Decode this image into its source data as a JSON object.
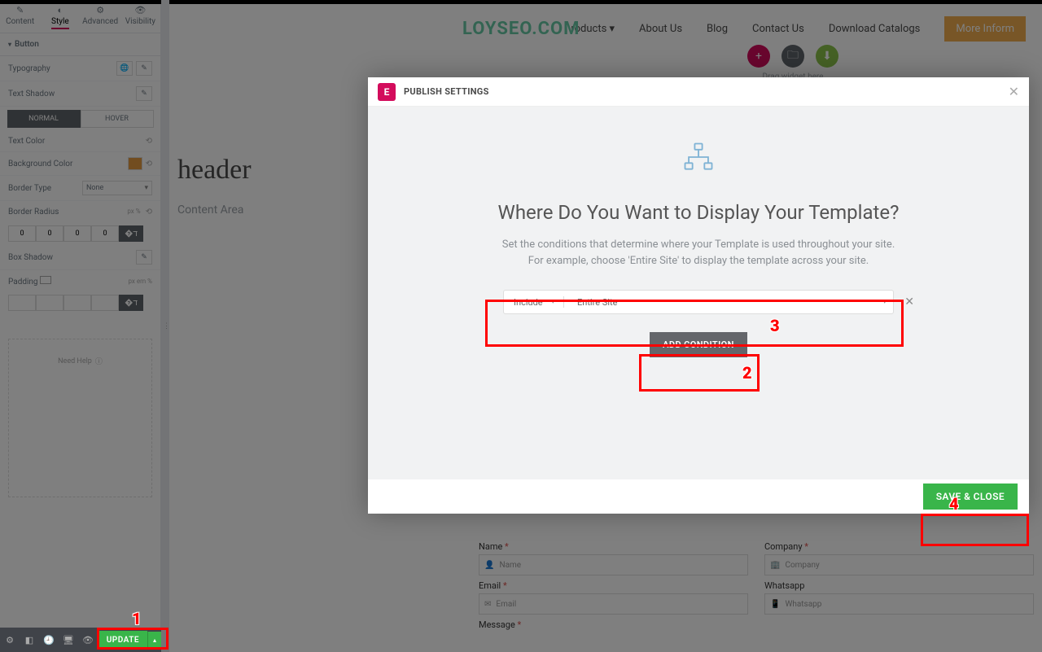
{
  "watermark": "LOYSEO.COM",
  "sidebar": {
    "tabs": [
      "Content",
      "Style",
      "Advanced",
      "Visibility"
    ],
    "active_tab_index": 1,
    "section": "Button",
    "rows": {
      "typography": "Typography",
      "text_shadow": "Text Shadow",
      "normal": "NORMAL",
      "hover": "HOVER",
      "text_color": "Text Color",
      "bg_color": "Background Color",
      "border_type": "Border Type",
      "border_type_value": "None",
      "border_radius": "Border Radius",
      "radius_values": [
        "0",
        "0",
        "0",
        "0"
      ],
      "box_shadow": "Box Shadow",
      "padding": "Padding",
      "help": "Need Help"
    },
    "bottom": {
      "update": "UPDATE"
    }
  },
  "canvas": {
    "logo": "LOYSEO.COM",
    "menu": {
      "products": "roducts",
      "about": "About Us",
      "blog": "Blog",
      "contact": "Contact Us",
      "download": "Download Catalogs",
      "cta": "More Inform"
    },
    "header_text": "header",
    "content_area": "Content Area",
    "drag_hint": "Drag widget here",
    "form": {
      "name_label": "Name",
      "name_ph": "Name",
      "company_label": "Company",
      "company_ph": "Company",
      "email_label": "Email",
      "email_ph": "Email",
      "whatsapp_label": "Whatsapp",
      "whatsapp_ph": "Whatsapp",
      "message_label": "Message"
    }
  },
  "modal": {
    "title": "PUBLISH SETTINGS",
    "heading": "Where Do You Want to Display Your Template?",
    "desc1": "Set the conditions that determine where your Template is used throughout your site.",
    "desc2": "For example, choose 'Entire Site' to display the template across your site.",
    "cond_mode": "Include",
    "cond_target": "Entire Site",
    "add_condition": "ADD CONDITION",
    "save_close": "SAVE & CLOSE"
  },
  "markers": {
    "m1": "1",
    "m2": "2",
    "m3": "3",
    "m4": "4"
  }
}
